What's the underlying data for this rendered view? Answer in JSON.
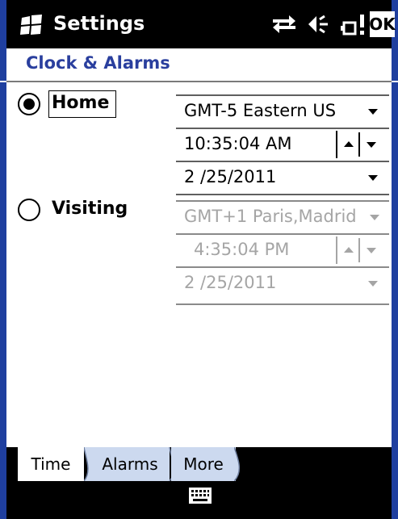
{
  "titlebar": {
    "title": "Settings",
    "ok_label": "OK",
    "icons": [
      "windows-logo-icon",
      "connectivity-icon",
      "volume-icon",
      "battery-icon"
    ]
  },
  "header": {
    "title": "Clock & Alarms"
  },
  "home": {
    "label": "Home",
    "selected": true,
    "timezone": "GMT-5 Eastern US",
    "time": "10:35:04 AM",
    "date": "2 /25/2011"
  },
  "visiting": {
    "label": "Visiting",
    "selected": false,
    "timezone": "GMT+1 Paris,Madrid",
    "time": "4:35:04 PM",
    "date": "2 /25/2011"
  },
  "tabs": [
    {
      "label": "Time",
      "active": true
    },
    {
      "label": "Alarms",
      "active": false
    },
    {
      "label": "More",
      "active": false
    }
  ],
  "bottombar": {
    "icons": [
      "keyboard-icon"
    ]
  },
  "colors": {
    "frame": "#1f3f9f",
    "header_text": "#2a3f9e",
    "disabled_text": "#a5a5a5",
    "tab_inactive": "#ccd9ef"
  }
}
